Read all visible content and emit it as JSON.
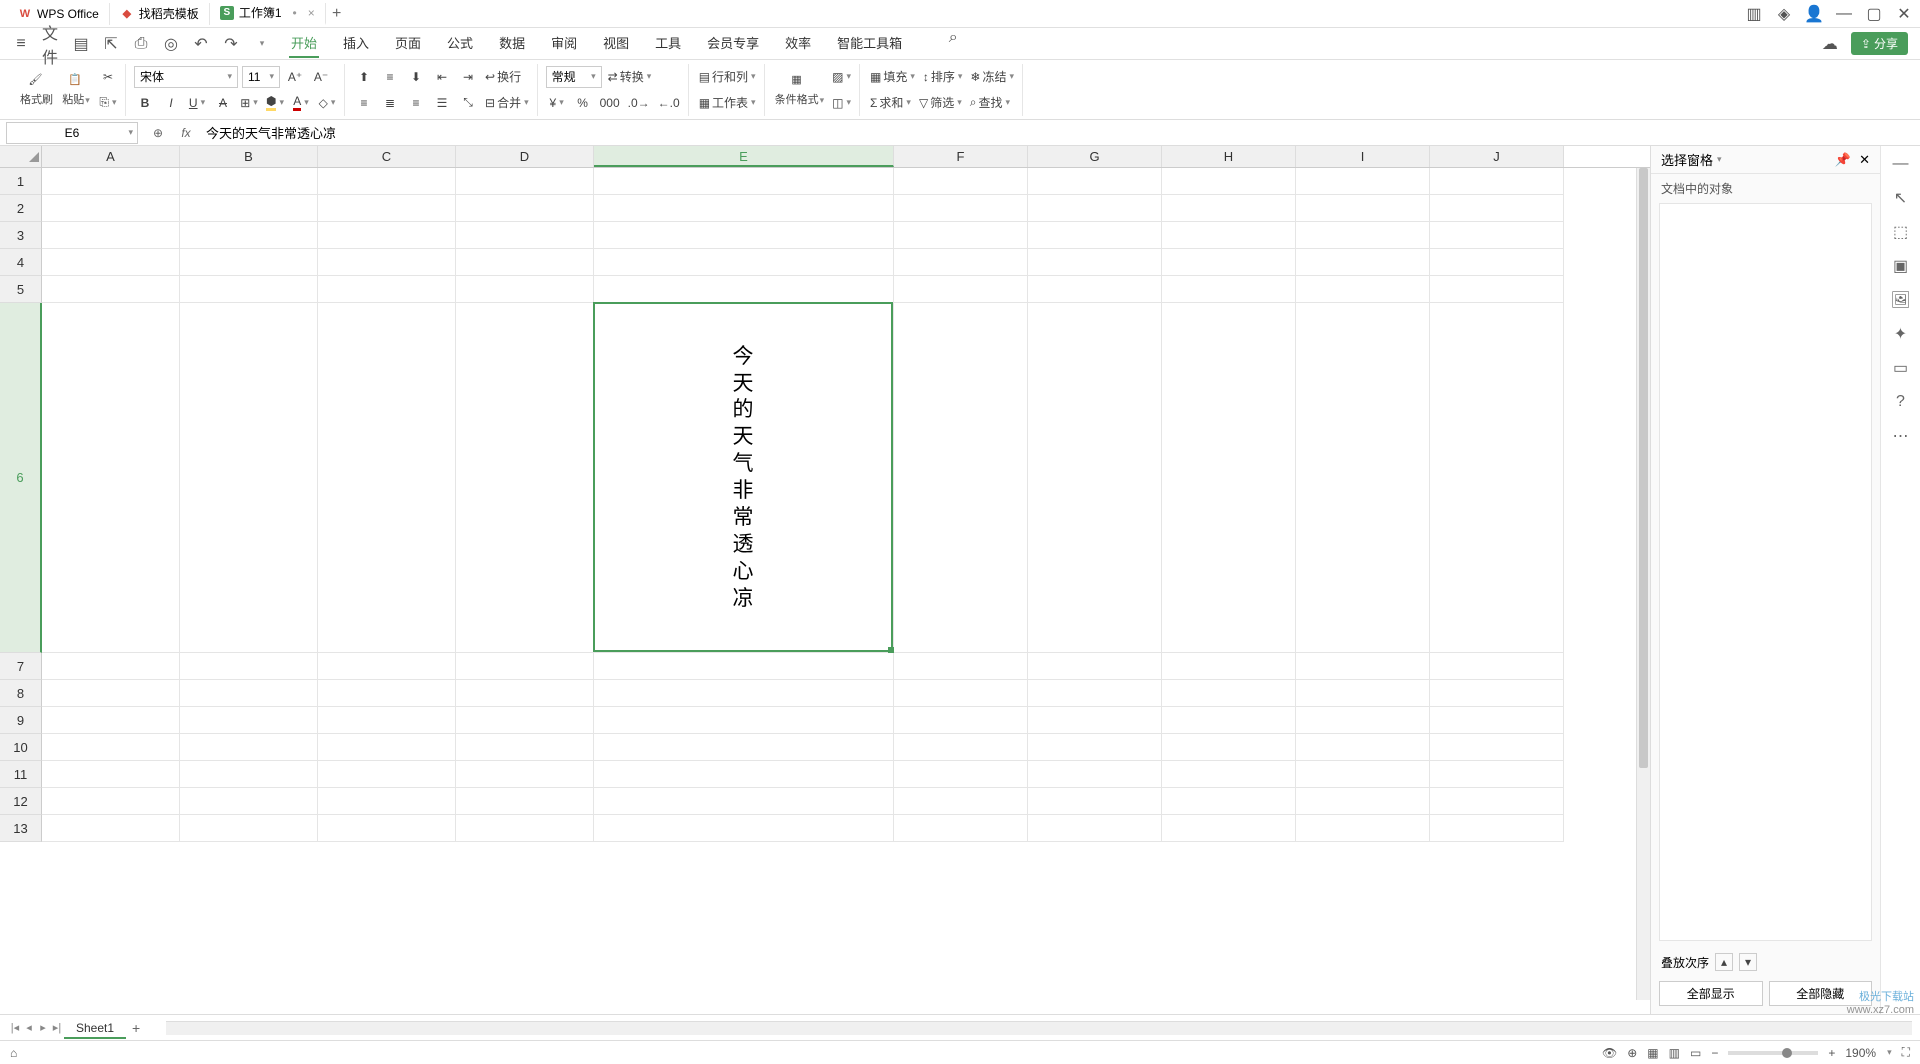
{
  "tabs": {
    "wps": "WPS Office",
    "tpl": "找稻壳模板",
    "doc": "工作簿1"
  },
  "file_menu": "文件",
  "menus": [
    "开始",
    "插入",
    "页面",
    "公式",
    "数据",
    "审阅",
    "视图",
    "工具",
    "会员专享",
    "效率",
    "智能工具箱"
  ],
  "active_menu": "开始",
  "share": "分享",
  "ribbon": {
    "format_painter": "格式刷",
    "paste": "粘贴",
    "font": "宋体",
    "size": "11",
    "number_format": "常规",
    "convert": "转换",
    "rows_cols": "行和列",
    "worksheet": "工作表",
    "wrap": "换行",
    "merge": "合并",
    "cond_fmt": "条件格式",
    "fill": "填充",
    "sort": "排序",
    "freeze": "冻结",
    "sum": "求和",
    "filter": "筛选",
    "find": "查找"
  },
  "name_box": "E6",
  "formula": "今天的天气非常透心凉",
  "cols": [
    "A",
    "B",
    "C",
    "D",
    "E",
    "F",
    "G",
    "H",
    "I",
    "J"
  ],
  "active_col": "E",
  "rows": [
    1,
    2,
    3,
    4,
    5,
    6,
    7,
    8,
    9,
    10,
    11,
    12,
    13
  ],
  "active_row": 6,
  "cell_text": "今\n天\n的\n天\n气\n非\n常\n透\n心\n凉",
  "panel": {
    "title": "选择窗格",
    "subtitle": "文档中的对象",
    "order": "叠放次序",
    "show_all": "全部显示",
    "hide_all": "全部隐藏"
  },
  "sheet_tab": "Sheet1",
  "zoom": "190%",
  "watermark": {
    "name": "极光下载站",
    "url": "www.xz7.com"
  }
}
